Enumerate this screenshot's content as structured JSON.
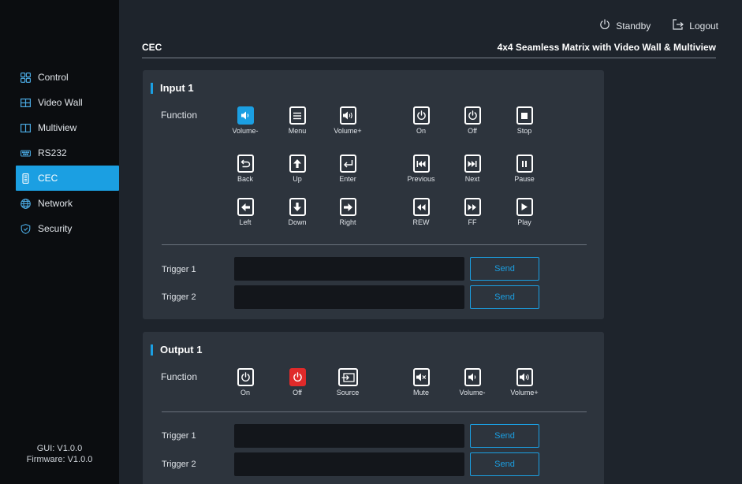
{
  "header": {
    "standby_label": "Standby",
    "logout_label": "Logout",
    "page_title": "CEC",
    "product_title": "4x4 Seamless Matrix with Video Wall & Multiview"
  },
  "sidebar": {
    "items": [
      {
        "label": "Control",
        "icon": "grid-icon"
      },
      {
        "label": "Video Wall",
        "icon": "video-wall-icon"
      },
      {
        "label": "Multiview",
        "icon": "multiview-icon"
      },
      {
        "label": "RS232",
        "icon": "serial-port-icon"
      },
      {
        "label": "CEC",
        "icon": "remote-icon",
        "active": true
      },
      {
        "label": "Network",
        "icon": "globe-icon"
      },
      {
        "label": "Security",
        "icon": "shield-icon"
      }
    ],
    "gui_version": "GUI: V1.0.0",
    "firmware_version": "Firmware: V1.0.0"
  },
  "input_panel": {
    "title": "Input 1",
    "function_label": "Function",
    "buttons": [
      {
        "label": "Volume-",
        "icon": "volume-down-icon",
        "selected": true
      },
      {
        "label": "Menu",
        "icon": "menu-icon"
      },
      {
        "label": "Volume+",
        "icon": "volume-up-icon"
      },
      {
        "label": "On",
        "icon": "power-icon"
      },
      {
        "label": "Off",
        "icon": "power-icon"
      },
      {
        "label": "Stop",
        "icon": "stop-icon"
      },
      {
        "label": "Back",
        "icon": "back-icon"
      },
      {
        "label": "Up",
        "icon": "arrow-up-icon"
      },
      {
        "label": "Enter",
        "icon": "enter-icon"
      },
      {
        "label": "Previous",
        "icon": "previous-icon"
      },
      {
        "label": "Next",
        "icon": "next-icon"
      },
      {
        "label": "Pause",
        "icon": "pause-icon"
      },
      {
        "label": "Left",
        "icon": "arrow-left-icon"
      },
      {
        "label": "Down",
        "icon": "arrow-down-icon"
      },
      {
        "label": "Right",
        "icon": "arrow-right-icon"
      },
      {
        "label": "REW",
        "icon": "rewind-icon"
      },
      {
        "label": "FF",
        "icon": "fast-forward-icon"
      },
      {
        "label": "Play",
        "icon": "play-icon"
      }
    ],
    "trigger1_label": "Trigger 1",
    "trigger2_label": "Trigger 2",
    "trigger1_value": "",
    "trigger2_value": "",
    "send_label": "Send"
  },
  "output_panel": {
    "title": "Output 1",
    "function_label": "Function",
    "buttons": [
      {
        "label": "On",
        "icon": "power-icon"
      },
      {
        "label": "Off",
        "icon": "power-icon",
        "active_red": true
      },
      {
        "label": "Source",
        "icon": "source-icon"
      },
      {
        "label": "Mute",
        "icon": "mute-icon"
      },
      {
        "label": "Volume-",
        "icon": "volume-down-icon"
      },
      {
        "label": "Volume+",
        "icon": "volume-up-icon"
      }
    ],
    "trigger1_label": "Trigger 1",
    "trigger2_label": "Trigger 2",
    "trigger1_value": "",
    "trigger2_value": "",
    "send_label": "Send"
  },
  "colors": {
    "accent": "#1b9fe2",
    "danger": "#e02a2a",
    "panel": "#2d343d",
    "sidebar": "#0b0d10"
  }
}
